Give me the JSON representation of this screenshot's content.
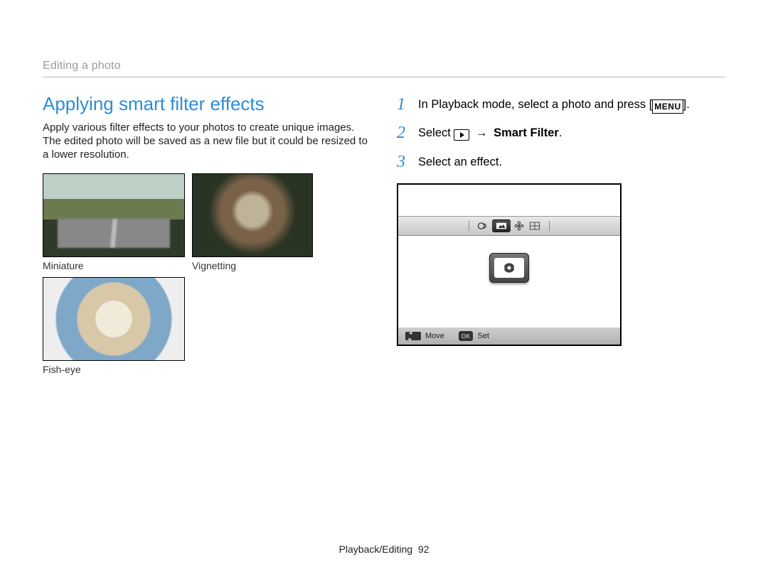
{
  "breadcrumb": "Editing a photo",
  "heading": "Applying smart filter effects",
  "paragraph": "Apply various filter effects to your photos to create unique images. The edited photo will be saved as a new file but it could be resized to a lower resolution.",
  "thumbs": [
    {
      "caption": "Miniature",
      "name": "thumb-miniature",
      "class": "miniature"
    },
    {
      "caption": "Vignetting",
      "name": "thumb-vignetting",
      "class": "vignetting"
    },
    {
      "caption": "Fish-eye",
      "name": "thumb-fisheye",
      "class": "fisheye"
    }
  ],
  "steps": {
    "s1": {
      "num": "1",
      "pre": "In Playback mode, select a photo and press [",
      "menu": "MENU",
      "post": "]."
    },
    "s2": {
      "num": "2",
      "pre": "Select ",
      "arrow": "→",
      "bold": "Smart Filter",
      "post": "."
    },
    "s3": {
      "num": "3",
      "text": "Select an effect."
    }
  },
  "lcd": {
    "bottom": {
      "move": "Move",
      "set": "Set",
      "ok": "OK"
    }
  },
  "footer": {
    "section": "Playback/Editing",
    "page": "92"
  }
}
